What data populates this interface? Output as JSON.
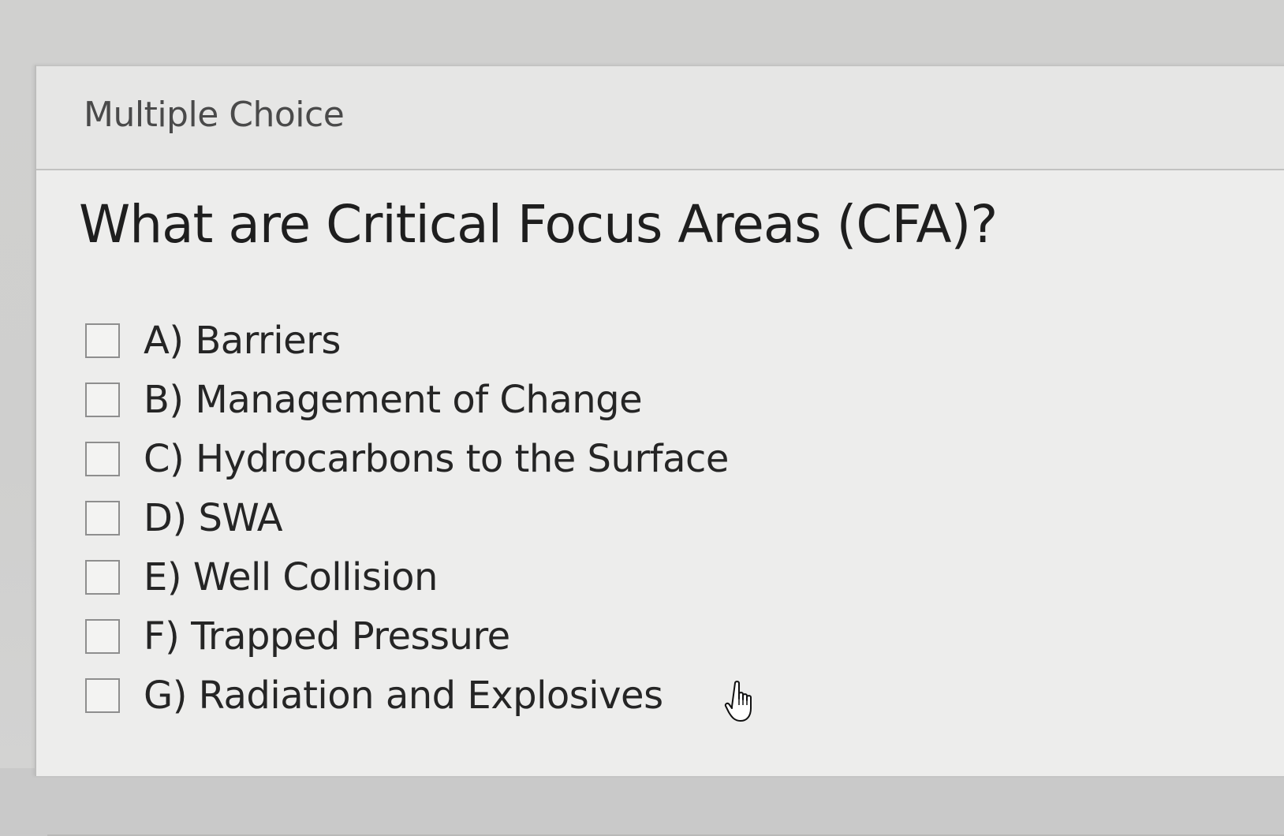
{
  "card": {
    "header_title": "Multiple Choice"
  },
  "question": {
    "text": "What are Critical Focus Areas (CFA)?"
  },
  "options": [
    {
      "label": "A) Barriers",
      "checked": false
    },
    {
      "label": "B) Management of Change",
      "checked": false
    },
    {
      "label": "C) Hydrocarbons to the Surface",
      "checked": false
    },
    {
      "label": "D) SWA",
      "checked": false
    },
    {
      "label": "E) Well Collision",
      "checked": false
    },
    {
      "label": "F) Trapped Pressure",
      "checked": false
    },
    {
      "label": "G) Radiation and Explosives",
      "checked": false
    }
  ],
  "icons": {
    "cursor": "hand-pointer-icon",
    "checkbox": "checkbox-unchecked-icon"
  },
  "colors": {
    "background": "#c9c9c9",
    "card": "#ededec",
    "text": "#1e1e1e",
    "header_text": "#4a4a4a",
    "checkbox_border": "#8e8e8e"
  }
}
